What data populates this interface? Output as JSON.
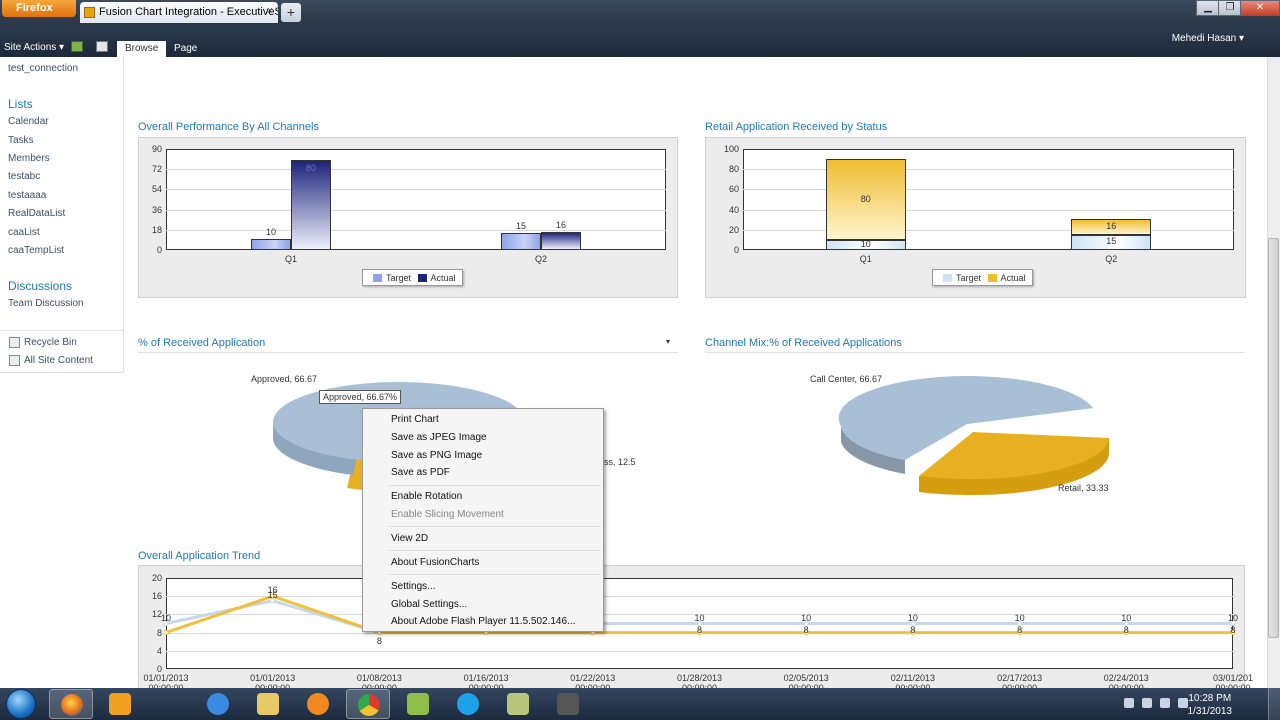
{
  "browser": {
    "menu_label": "Firefox",
    "tab_title": "Fusion Chart Integration - ExecutiveSum...",
    "new_tab": "+"
  },
  "ribbon": {
    "site_actions": "Site Actions",
    "tabs": [
      "Browse",
      "Page"
    ],
    "user": "Mehedi Hasan"
  },
  "leftnav": {
    "top_item": "test_connection",
    "lists_heading": "Lists",
    "lists": [
      "Calendar",
      "Tasks",
      "Members",
      "testabc",
      "testaaaa",
      "RealDataList",
      "caaList",
      "caaTempList"
    ],
    "discussions_heading": "Discussions",
    "discussions": [
      "Team Discussion"
    ],
    "recycle": "Recycle Bin",
    "all_content": "All Site Content"
  },
  "sections": {
    "overall": "Overall Performance By All Channels",
    "retail": "Retail Application Received by Status",
    "received": "% of Received Application",
    "channel": "Channel Mix:% of Received Applications",
    "trend": "Overall Application Trend"
  },
  "chart_data": [
    {
      "type": "bar",
      "title": "Overall Performance By All Channels",
      "categories": [
        "Q1",
        "Q2"
      ],
      "series": [
        {
          "name": "Target",
          "values": [
            10,
            15
          ]
        },
        {
          "name": "Actual",
          "values": [
            80,
            16
          ]
        }
      ],
      "ylim": [
        0,
        90
      ],
      "yticks": [
        "90",
        "72",
        "54",
        "36",
        "18",
        "0"
      ],
      "legend": "bottom"
    },
    {
      "type": "bar",
      "title": "Retail Application Received by Status",
      "stacked": true,
      "categories": [
        "Q1",
        "Q2"
      ],
      "series": [
        {
          "name": "Target",
          "values": [
            10,
            15
          ]
        },
        {
          "name": "Actual",
          "values": [
            80,
            16
          ]
        }
      ],
      "ylim": [
        0,
        100
      ],
      "yticks": [
        "100",
        "80",
        "60",
        "40",
        "20",
        "0"
      ],
      "legend": "bottom"
    },
    {
      "type": "pie",
      "title": "% of Received Application",
      "slices": [
        {
          "label": "Approved, 66.67",
          "value": 66.67
        },
        {
          "label": "ss, 12.5",
          "value": 12.5
        }
      ],
      "tooltip": "Approved, 66.67%"
    },
    {
      "type": "pie",
      "title": "Channel Mix:% of Received Applications",
      "slices": [
        {
          "label": "Call Center, 66.67",
          "value": 66.67
        },
        {
          "label": "Retail, 33.33",
          "value": 33.33
        }
      ]
    },
    {
      "type": "line",
      "title": "Overall Application Trend",
      "ylim": [
        0,
        20
      ],
      "yticks": [
        "20",
        "16",
        "12",
        "8",
        "4",
        "0"
      ],
      "x": [
        "01/01/2013",
        "01/01/2013",
        "01/08/2013",
        "01/16/2013",
        "01/22/2013",
        "01/28/2013",
        "02/05/2013",
        "02/11/2013",
        "02/17/2013",
        "02/24/2013",
        "03/01/201"
      ],
      "x_sub": "00:00:00",
      "series": [
        {
          "values": [
            10,
            15,
            8,
            10,
            10,
            10,
            10,
            10,
            10,
            10,
            10
          ],
          "color": "#c7d6e8"
        },
        {
          "values": [
            8,
            16,
            8,
            8,
            8,
            8,
            8,
            8,
            8,
            8,
            8
          ],
          "color": "#f0c040"
        }
      ],
      "data_labels": [
        {
          "text": "10",
          "i": 0,
          "v": 10
        },
        {
          "text": "15",
          "i": 1,
          "v": 15
        },
        {
          "text": "16",
          "i": 1,
          "v": 16
        },
        {
          "text": "8",
          "i": 2,
          "v": 8
        },
        {
          "text": "10",
          "i": 5,
          "v": 10
        },
        {
          "text": "8",
          "i": 5,
          "v": 8
        },
        {
          "text": "10",
          "i": 6,
          "v": 10
        },
        {
          "text": "8",
          "i": 6,
          "v": 8
        },
        {
          "text": "10",
          "i": 7,
          "v": 10
        },
        {
          "text": "8",
          "i": 7,
          "v": 8
        },
        {
          "text": "10",
          "i": 8,
          "v": 10
        },
        {
          "text": "8",
          "i": 8,
          "v": 8
        },
        {
          "text": "10",
          "i": 9,
          "v": 10
        },
        {
          "text": "8",
          "i": 9,
          "v": 8
        },
        {
          "text": "10",
          "i": 10,
          "v": 10
        },
        {
          "text": "8",
          "i": 10,
          "v": 8
        }
      ]
    }
  ],
  "context_menu": {
    "items": [
      {
        "label": "Print Chart",
        "enabled": true
      },
      {
        "label": "Save as JPEG Image",
        "enabled": true
      },
      {
        "label": "Save as PNG Image",
        "enabled": true
      },
      {
        "label": "Save as PDF",
        "enabled": true
      },
      {
        "label": "Enable Rotation",
        "enabled": true
      },
      {
        "label": "Enable Slicing Movement",
        "enabled": false
      },
      {
        "label": "View 2D",
        "enabled": true
      },
      {
        "label": "About FusionCharts",
        "enabled": true
      },
      {
        "label": "Settings...",
        "enabled": true
      },
      {
        "label": "Global Settings...",
        "enabled": true
      },
      {
        "label": "About Adobe Flash Player 11.5.502.146...",
        "enabled": true
      }
    ]
  },
  "taskbar": {
    "time": "10:28 PM",
    "date": "1/31/2013",
    "apps": [
      "outlook-icon",
      "internet-explorer-icon",
      "explorer-folder-icon",
      "media-player-icon",
      "chrome-icon",
      "file-manager-icon",
      "skype-icon",
      "notepad-icon",
      "camera-icon"
    ]
  },
  "colors": {
    "accent": "#2278b5",
    "target_blue": "#8fa3e8",
    "actual_navy": "#1c247a",
    "retail_gold": "#f0bd2e",
    "pie_blue": "#a9bfd6",
    "pie_gold": "#e8b020"
  }
}
